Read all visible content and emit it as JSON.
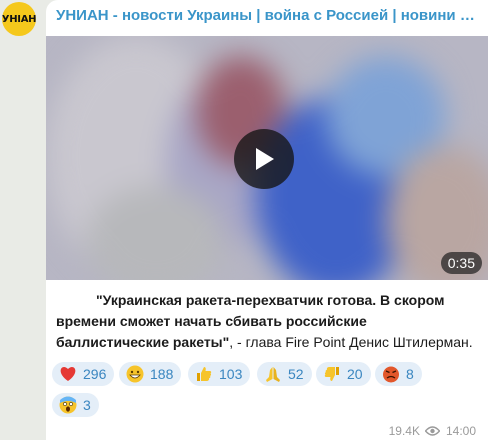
{
  "channel": {
    "avatar_text": "УНІАН",
    "title": "УНИАН - новости Украины | война с Россией | новини України - Україна"
  },
  "video": {
    "duration": "0:35"
  },
  "message": {
    "bold_text": "\"Украинская ракета-перехватчик готова. В скором времени сможет начать сбивать российские баллистические ракеты\"",
    "rest_text": ", - глава Fire Point Денис Штилерман."
  },
  "reactions": [
    {
      "icon": "heart-icon",
      "count": "296",
      "color": "#e53935"
    },
    {
      "icon": "grin-face-icon",
      "count": "188",
      "color": "#f4b400"
    },
    {
      "icon": "thumbs-up-icon",
      "count": "103",
      "color": "#f4b400"
    },
    {
      "icon": "pray-hands-icon",
      "count": "52",
      "color": "#f4b400"
    },
    {
      "icon": "thumbs-down-icon",
      "count": "20",
      "color": "#f4b400"
    },
    {
      "icon": "angry-face-icon",
      "count": "8",
      "color": "#d84315"
    },
    {
      "icon": "scream-face-icon",
      "count": "3",
      "color": "#64b5f6"
    }
  ],
  "footer": {
    "views": "19.4K",
    "time": "14:00"
  },
  "colors": {
    "accent": "#3a95c9",
    "reaction_bg": "#e4eef8",
    "chat_bg": "#e9ebe6"
  }
}
